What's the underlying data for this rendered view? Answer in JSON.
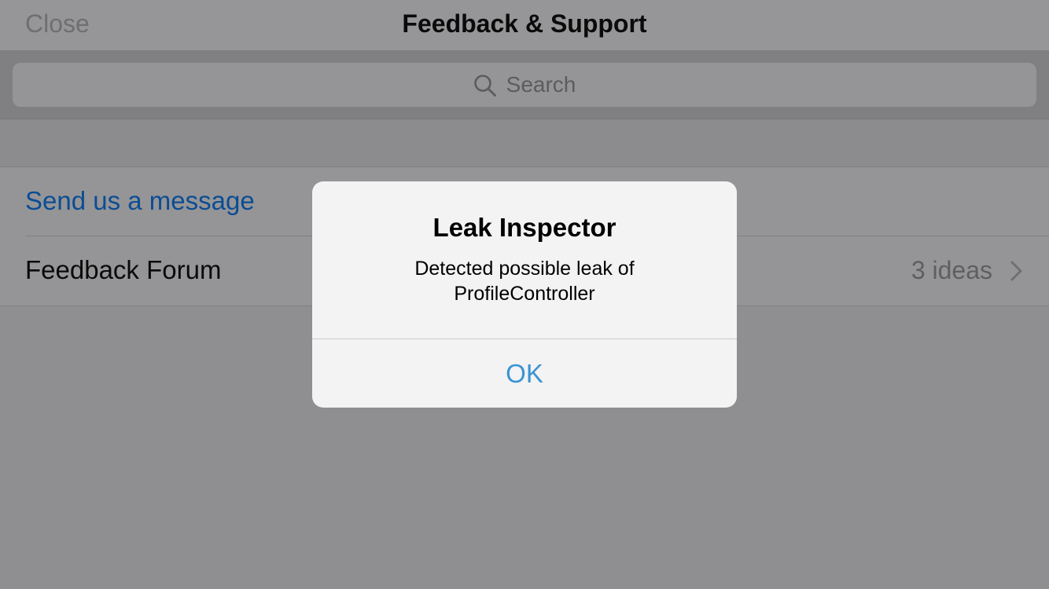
{
  "navbar": {
    "close_label": "Close",
    "title": "Feedback & Support"
  },
  "search": {
    "placeholder": "Search",
    "icon": "search-icon"
  },
  "table": {
    "rows": [
      {
        "label": "Send us a message",
        "detail": ""
      },
      {
        "label": "Feedback Forum",
        "detail": "3 ideas",
        "accessory": "chevron-right-icon"
      }
    ]
  },
  "alert": {
    "title": "Leak Inspector",
    "message_line1": "Detected possible leak of",
    "message_line2": "ProfileController",
    "button_label": "OK"
  },
  "colors": {
    "link": "#0b4d93",
    "alert_button": "#3a93d3",
    "dim_background": "#8f8f92"
  }
}
